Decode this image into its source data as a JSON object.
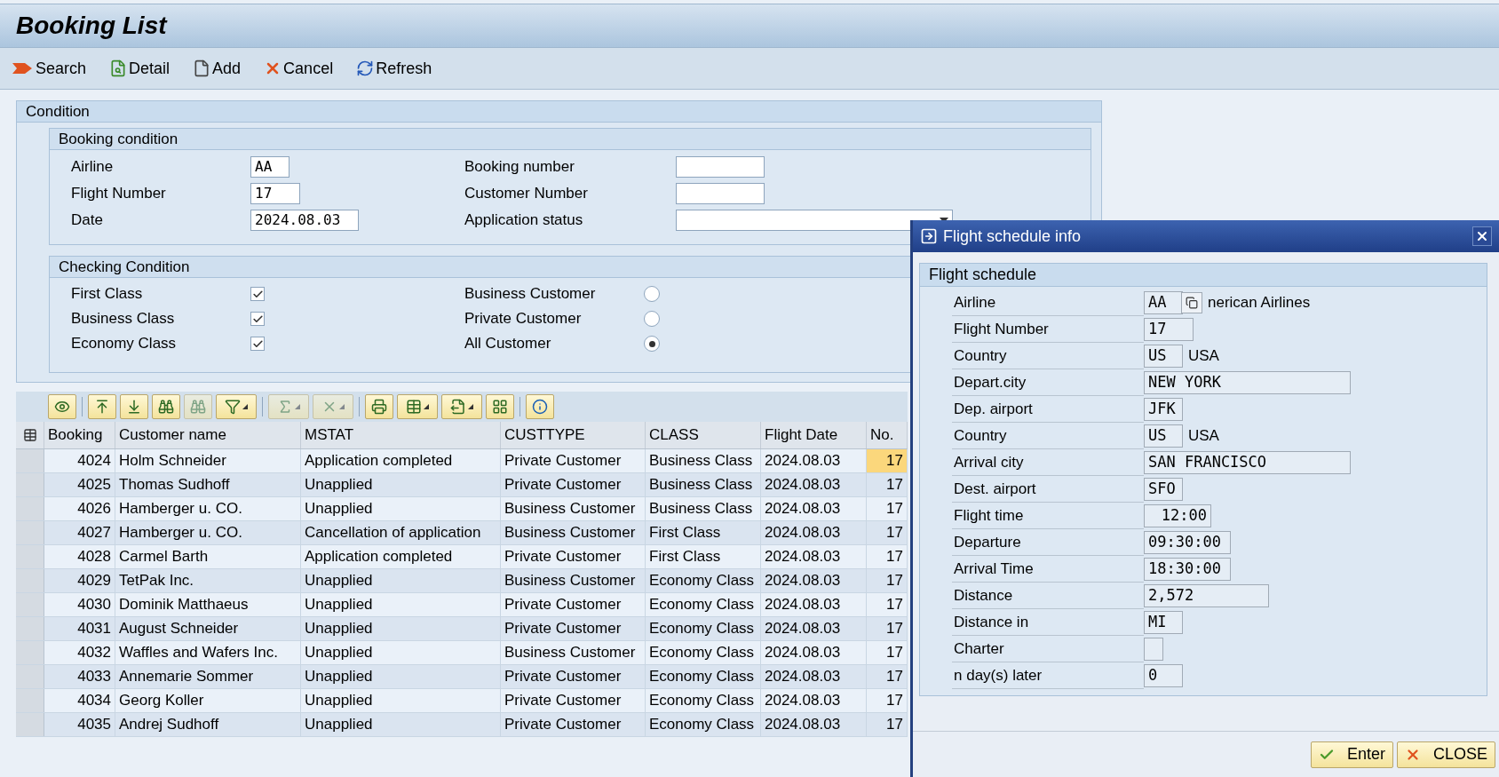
{
  "title": "Booking List",
  "toolbar": [
    {
      "kind": "search",
      "label": "Search"
    },
    {
      "kind": "detail",
      "label": "Detail"
    },
    {
      "kind": "add",
      "label": "Add"
    },
    {
      "kind": "cancel",
      "label": "Cancel"
    },
    {
      "kind": "refresh",
      "label": "Refresh"
    }
  ],
  "condition": {
    "title": "Condition",
    "booking": {
      "title": "Booking condition",
      "fields": [
        {
          "label": "Airline",
          "value": "AA",
          "kind": "code"
        },
        {
          "label": "Booking number",
          "kind": "text"
        },
        {
          "label": "Flight Number",
          "value": "17",
          "kind": "number"
        },
        {
          "label": "Customer Number",
          "kind": "text"
        },
        {
          "label": "Date",
          "value": "2024.08.03",
          "kind": "date"
        },
        {
          "label": "Application status",
          "kind": "dropdown"
        }
      ]
    },
    "checking": {
      "title": "Checking Condition",
      "options": [
        {
          "label": "First Class",
          "kind": "checkbox",
          "checked": true
        },
        {
          "label": "Business Customer",
          "kind": "radio",
          "selected": false
        },
        {
          "label": "Business Class",
          "kind": "checkbox",
          "checked": true
        },
        {
          "label": "Private Customer",
          "kind": "radio",
          "selected": false
        },
        {
          "label": "Economy Class",
          "kind": "checkbox",
          "checked": true
        },
        {
          "label": "All Customer",
          "kind": "radio",
          "selected": true
        }
      ]
    }
  },
  "grid": {
    "toolbar": [
      {
        "kind": "details",
        "disabled": false,
        "dropdown": false
      },
      {
        "kind": "top",
        "disabled": false,
        "dropdown": false
      },
      {
        "kind": "bottom",
        "disabled": false,
        "dropdown": false
      },
      {
        "kind": "find",
        "disabled": false,
        "dropdown": false
      },
      {
        "kind": "find_next",
        "disabled": true,
        "dropdown": false
      },
      {
        "kind": "filter",
        "disabled": false,
        "dropdown": true
      },
      {
        "kind": "sum",
        "disabled": true,
        "dropdown": true
      },
      {
        "kind": "subtotal",
        "disabled": true,
        "dropdown": true
      },
      {
        "kind": "print",
        "disabled": false,
        "dropdown": false
      },
      {
        "kind": "views",
        "disabled": false,
        "dropdown": true
      },
      {
        "kind": "export",
        "disabled": false,
        "dropdown": true
      },
      {
        "kind": "layout",
        "disabled": false,
        "dropdown": false
      },
      {
        "kind": "info",
        "disabled": false,
        "dropdown": false
      }
    ],
    "columns": [
      "Booking",
      "Customer name",
      "MSTAT",
      "CUSTTYPE",
      "CLASS",
      "Flight Date",
      "No."
    ],
    "rows": [
      {
        "selected": true,
        "cells": [
          "4024",
          "Holm Schneider",
          "Application completed",
          "Private Customer",
          "Business Class",
          "2024.08.03",
          "17"
        ]
      },
      {
        "selected": false,
        "cells": [
          "4025",
          "Thomas Sudhoff",
          "Unapplied",
          "Private Customer",
          "Business Class",
          "2024.08.03",
          "17"
        ]
      },
      {
        "selected": false,
        "cells": [
          "4026",
          "Hamberger u. CO.",
          "Unapplied",
          "Business Customer",
          "Business Class",
          "2024.08.03",
          "17"
        ]
      },
      {
        "selected": false,
        "cells": [
          "4027",
          "Hamberger u. CO.",
          "Cancellation of application",
          "Business Customer",
          "First Class",
          "2024.08.03",
          "17"
        ]
      },
      {
        "selected": false,
        "cells": [
          "4028",
          "Carmel Barth",
          "Application completed",
          "Private Customer",
          "First Class",
          "2024.08.03",
          "17"
        ]
      },
      {
        "selected": false,
        "cells": [
          "4029",
          "TetPak Inc.",
          "Unapplied",
          "Business Customer",
          "Economy Class",
          "2024.08.03",
          "17"
        ]
      },
      {
        "selected": false,
        "cells": [
          "4030",
          "Dominik Matthaeus",
          "Unapplied",
          "Private Customer",
          "Economy Class",
          "2024.08.03",
          "17"
        ]
      },
      {
        "selected": false,
        "cells": [
          "4031",
          "August Schneider",
          "Unapplied",
          "Private Customer",
          "Economy Class",
          "2024.08.03",
          "17"
        ]
      },
      {
        "selected": false,
        "cells": [
          "4032",
          "Waffles and Wafers Inc.",
          "Unapplied",
          "Business Customer",
          "Economy Class",
          "2024.08.03",
          "17"
        ]
      },
      {
        "selected": false,
        "cells": [
          "4033",
          "Annemarie Sommer",
          "Unapplied",
          "Private Customer",
          "Economy Class",
          "2024.08.03",
          "17"
        ]
      },
      {
        "selected": false,
        "cells": [
          "4034",
          "Georg Koller",
          "Unapplied",
          "Private Customer",
          "Economy Class",
          "2024.08.03",
          "17"
        ]
      },
      {
        "selected": false,
        "cells": [
          "4035",
          "Andrej Sudhoff",
          "Unapplied",
          "Private Customer",
          "Economy Class",
          "2024.08.03",
          "17"
        ]
      }
    ]
  },
  "dialog": {
    "title": "Flight schedule info",
    "section": "Flight schedule",
    "fields": [
      {
        "label": "Airline",
        "value": "AA",
        "kind": "code",
        "lookup": true,
        "text": "nerican Airlines"
      },
      {
        "label": "Flight Number",
        "value": "17",
        "kind": "number"
      },
      {
        "label": "Country",
        "value": "US",
        "kind": "code",
        "text": "USA"
      },
      {
        "label": "Depart.city",
        "value": "NEW YORK",
        "kind": "city"
      },
      {
        "label": "Dep. airport",
        "value": "JFK",
        "kind": "code"
      },
      {
        "label": "Country",
        "value": "US",
        "kind": "code",
        "text": "USA"
      },
      {
        "label": "Arrival city",
        "value": "SAN FRANCISCO",
        "kind": "city"
      },
      {
        "label": "Dest. airport",
        "value": "SFO",
        "kind": "code"
      },
      {
        "label": "Flight time",
        "value": "12:00",
        "kind": "duration"
      },
      {
        "label": "Departure",
        "value": "09:30:00",
        "kind": "time"
      },
      {
        "label": "Arrival Time",
        "value": "18:30:00",
        "kind": "time"
      },
      {
        "label": "Distance",
        "value": "2,572",
        "kind": "quantity"
      },
      {
        "label": "Distance in",
        "value": "MI",
        "kind": "code"
      },
      {
        "label": "Charter",
        "kind": "checkbox",
        "checked": false
      },
      {
        "label": "n day(s) later",
        "value": "0",
        "kind": "code"
      }
    ],
    "buttons": [
      {
        "kind": "enter",
        "label": "Enter"
      },
      {
        "kind": "close",
        "label": "CLOSE"
      }
    ]
  }
}
